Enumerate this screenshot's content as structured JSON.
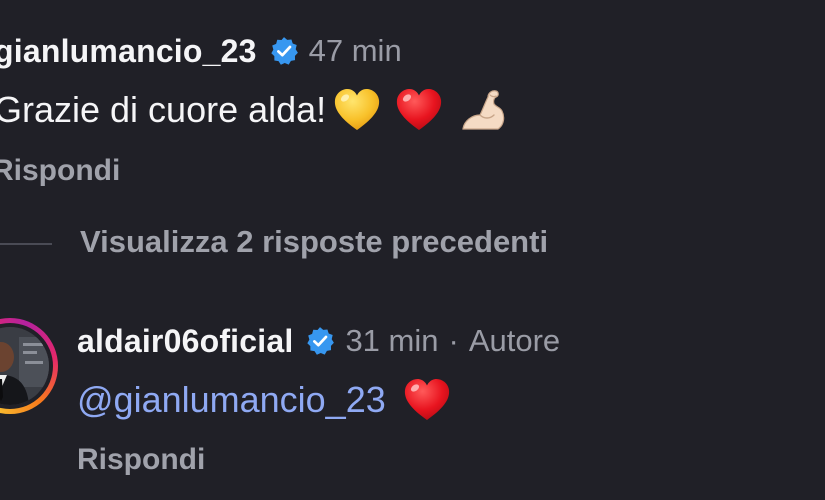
{
  "comments": [
    {
      "username": "gianlumancio_23",
      "verified": true,
      "time": "47 min",
      "text": "Grazie di cuore alda!",
      "emojis": [
        "yellow-heart",
        "red-heart",
        "flexed-biceps"
      ],
      "reply_label": "Rispondi"
    },
    {
      "username": "aldair06oficial",
      "verified": true,
      "time": "31 min",
      "separator": "·",
      "author_label": "Autore",
      "mention": "@gianlumancio_23",
      "emojis": [
        "red-heart"
      ],
      "reply_label": "Rispondi"
    }
  ],
  "thread": {
    "view_previous_label": "Visualizza 2 risposte precedenti"
  },
  "colors": {
    "background": "#202027",
    "primary_text": "#f5f5f7",
    "secondary_text": "#9a9ca6",
    "mention": "#8fa9f3",
    "verified": "#3797f0"
  }
}
